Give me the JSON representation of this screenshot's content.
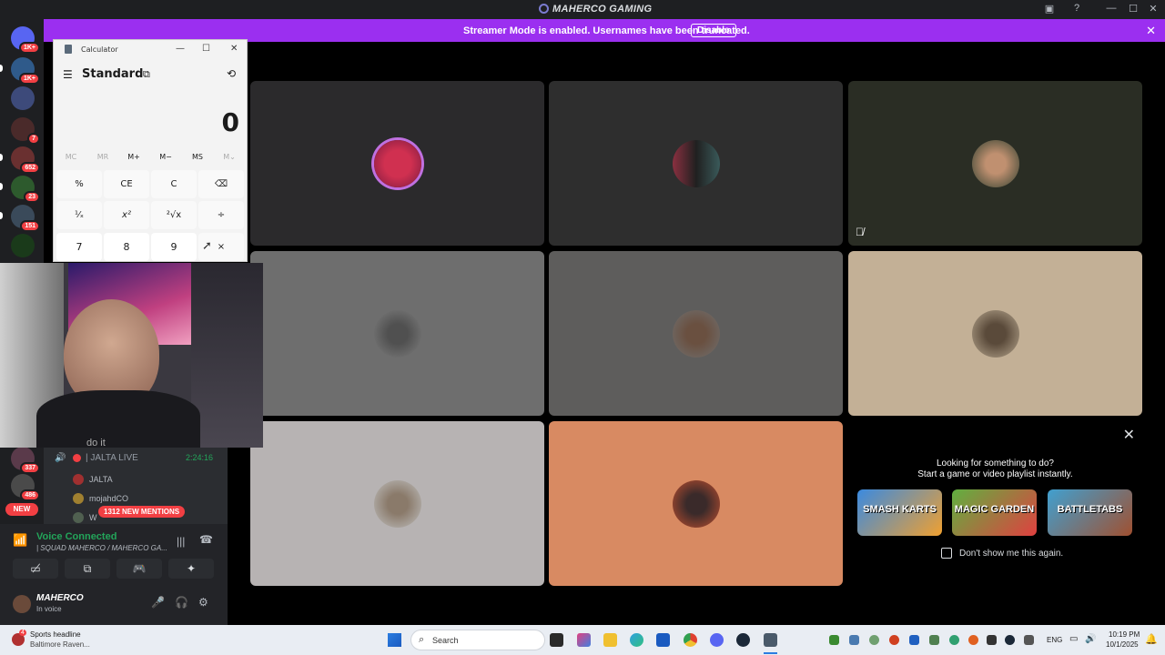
{
  "window": {
    "title": "MAHERCO GAMING"
  },
  "banner": {
    "message": "Streamer Mode is enabled. Usernames have been truncated.",
    "button": "Disable"
  },
  "servers": [
    {
      "badge": "1K+"
    },
    {
      "badge": "1K+"
    },
    {
      "badge": ""
    },
    {
      "badge": "7"
    },
    {
      "badge": "652"
    },
    {
      "badge": "23"
    },
    {
      "badge": "151"
    },
    {
      "badge": ""
    },
    {
      "badge": "337"
    },
    {
      "badge": "486"
    },
    {
      "badge": "NEW"
    }
  ],
  "voice_channel": {
    "name": "| JALTA LIVE",
    "duration": "2:24:16",
    "members": [
      "JALTA",
      "mojahdCO",
      "W"
    ]
  },
  "mentions_badge": "1312 NEW MENTIONS",
  "voice_status": {
    "label": "Voice Connected",
    "channel": "| SQUAD MAHERCO / MAHERCO GA..."
  },
  "user": {
    "name": "MAHERCO",
    "status": "In voice"
  },
  "webcam": {
    "caption": "do it"
  },
  "calculator": {
    "title": "Calculator",
    "mode": "Standard",
    "display": "0",
    "memory": [
      "MC",
      "MR",
      "M+",
      "M−",
      "MS",
      "M⌄"
    ],
    "keys_row1": [
      "%",
      "CE",
      "C",
      "⌫"
    ],
    "keys_row2": [
      "¹⁄ₓ",
      "x²",
      "²√x",
      "÷"
    ],
    "keys_row3": [
      "7",
      "8",
      "9",
      "×"
    ]
  },
  "activity_promo": {
    "heading": "Looking for something to do?",
    "subheading": "Start a game or video playlist instantly.",
    "games": [
      "SMASH KARTS",
      "MAGIC GARDEN",
      "BATTLETABS"
    ],
    "checkbox_label": "Don't show me this again."
  },
  "taskbar": {
    "news_title": "Sports headline",
    "news_sub": "Baltimore Raven...",
    "news_badge": "4",
    "search_placeholder": "Search",
    "language": "ENG",
    "time": "10:19 PM",
    "date": "10/1/2025"
  },
  "colors": {
    "accent": "#9b2ff0",
    "voice_green": "#23a55a",
    "mention_red": "#f23f43"
  }
}
